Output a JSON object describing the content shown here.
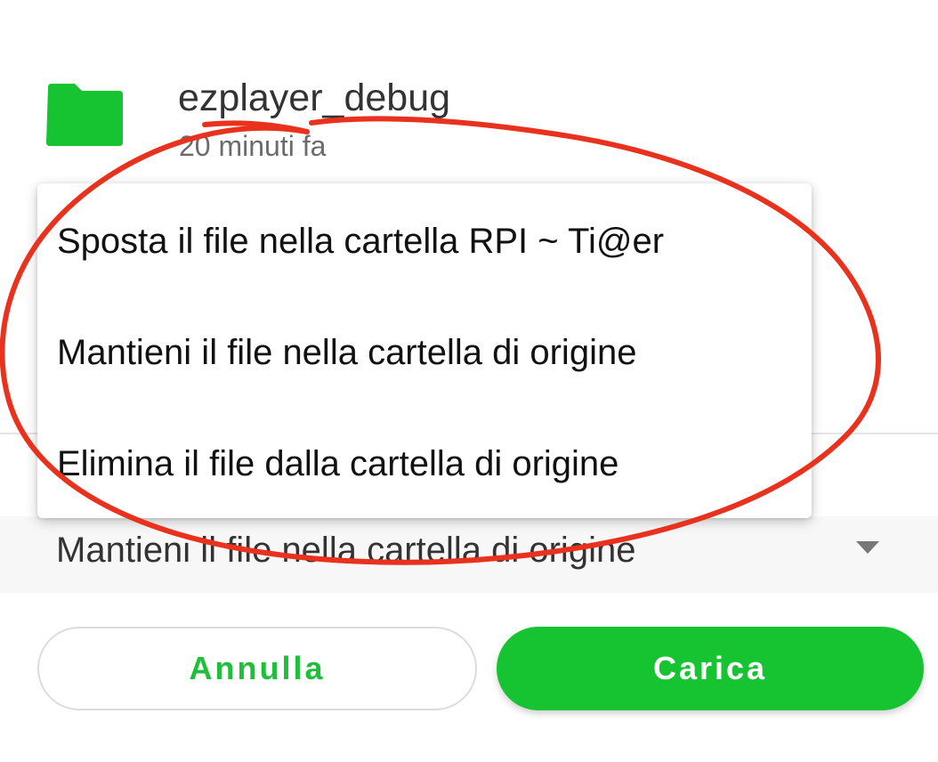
{
  "file": {
    "icon": "folder-icon",
    "name": "ezplayer_debug",
    "time": "20 minuti fa"
  },
  "menu": {
    "items": [
      {
        "label": "Sposta il file nella cartella RPI ~ Ti@er"
      },
      {
        "label": "Mantieni il file nella cartella di origine"
      },
      {
        "label": "Elimina il file dalla cartella di origine"
      }
    ]
  },
  "select": {
    "value": "Mantieni il file nella cartella di origine",
    "icon": "dropdown-arrow-icon"
  },
  "buttons": {
    "cancel_label": "Annulla",
    "upload_label": "Carica"
  },
  "colors": {
    "accent": "#16c432",
    "annotation": "#e8321e"
  }
}
